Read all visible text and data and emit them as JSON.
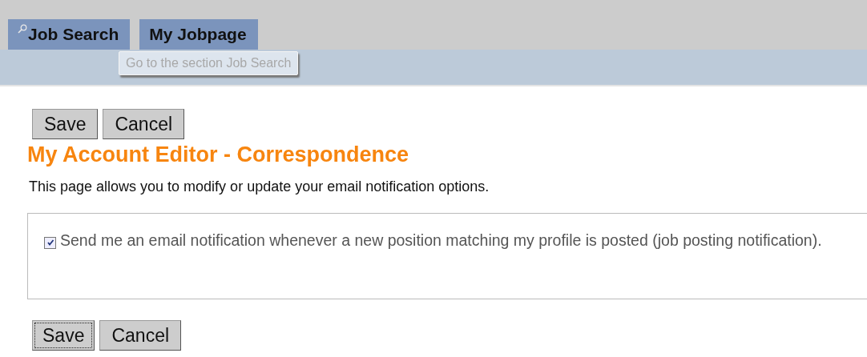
{
  "tabs": [
    {
      "label": "Job Search",
      "kind": "search"
    },
    {
      "label": "My Jobpage",
      "kind": "plain"
    }
  ],
  "tooltip": "Go to the section Job Search",
  "top_buttons": [
    {
      "label": "Save",
      "focused": false
    },
    {
      "label": "Cancel",
      "focused": false
    }
  ],
  "title": "My Account Editor - Correspondence",
  "description": "This page allows you to modify or update your email notification options.",
  "option": {
    "label": "Send me an email notification whenever a new position matching my profile is posted (job posting notification).",
    "checked": true
  },
  "bottom_buttons": [
    {
      "label": "Save",
      "focused": true
    },
    {
      "label": "Cancel",
      "focused": false
    }
  ]
}
